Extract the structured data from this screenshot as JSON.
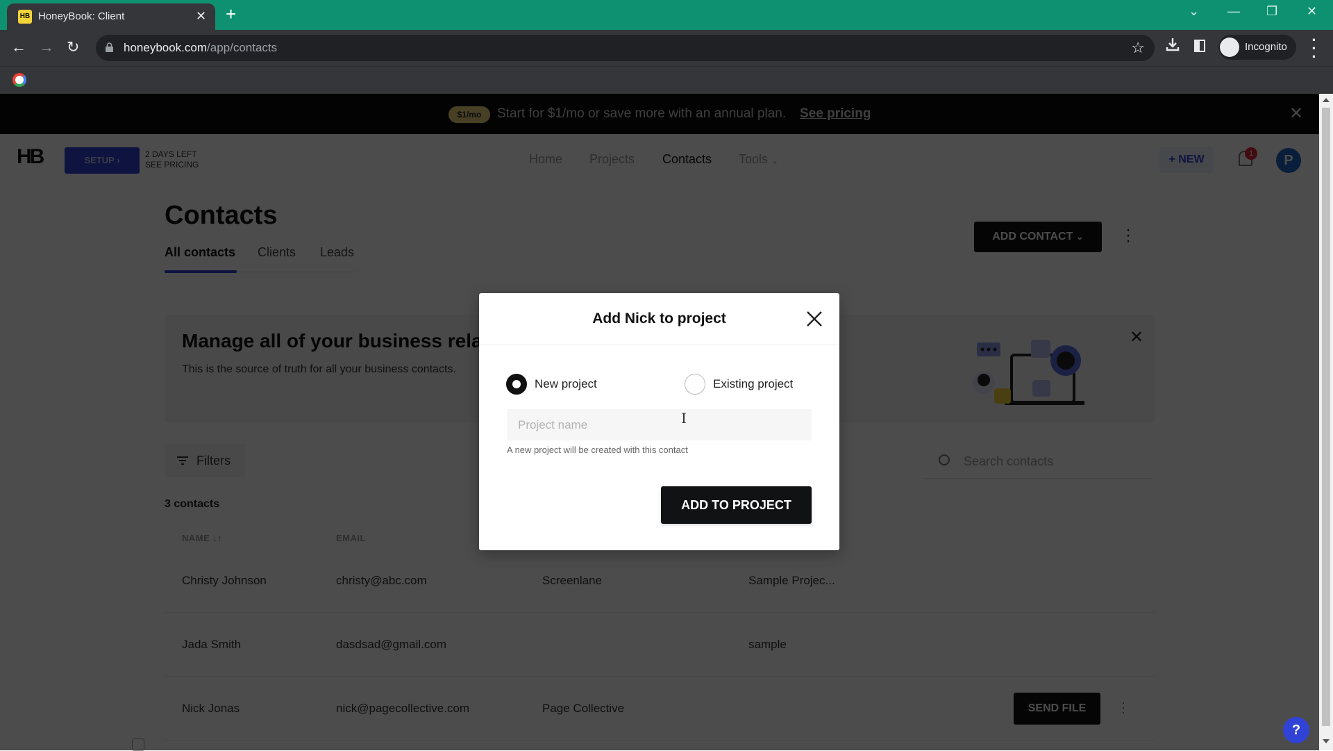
{
  "browser": {
    "tab_title": "HoneyBook: Client",
    "tab_favicon": "HB",
    "url_host": "honeybook.com",
    "url_path": "/app/contacts",
    "profile_label": "Incognito",
    "icons": [
      "back-icon",
      "forward-icon",
      "reload-icon",
      "lock-icon",
      "star-icon",
      "download-icon",
      "side-panel-icon",
      "incognito-icon",
      "kebab-menu-icon",
      "google-icon"
    ]
  },
  "promo": {
    "badge": "$1/mo",
    "text": "Start for $1/mo or save more with an annual plan.",
    "link": "See pricing"
  },
  "header": {
    "logo": "HB",
    "setup_label": "SETUP",
    "trial_line1": "2 DAYS LEFT",
    "trial_line2": "SEE PRICING",
    "nav": [
      "Home",
      "Projects",
      "Contacts",
      "Tools"
    ],
    "active_nav": "Contacts",
    "new_label": "+ NEW",
    "notification_count": "1",
    "avatar_initial": "P"
  },
  "contacts": {
    "title": "Contacts",
    "tabs": [
      "All contacts",
      "Clients",
      "Leads"
    ],
    "active_tab": "All contacts",
    "add_contact_label": "ADD CONTACT",
    "info_title": "Manage all of your business relationships",
    "info_title_visible": "Manage all of your business rela",
    "info_subtitle": "This is the source of truth for all your business contacts.",
    "filters_label": "Filters",
    "search_placeholder": "Search contacts",
    "count_label": "3 contacts",
    "columns": [
      "NAME",
      "EMAIL"
    ],
    "rows": [
      {
        "name": "Christy Johnson",
        "email": "christy@abc.com",
        "company": "Screenlane",
        "project": "Sample Projec..."
      },
      {
        "name": "Jada Smith",
        "email": "dasdsad@gmail.com",
        "company": "",
        "project": "sample"
      },
      {
        "name": "Nick Jonas",
        "email": "nick@pagecollective.com",
        "company": "Page Collective",
        "project": ""
      }
    ],
    "send_file_label": "SEND FILE",
    "help_label": "?"
  },
  "modal": {
    "title": "Add Nick to project",
    "options": [
      "New project",
      "Existing project"
    ],
    "selected_option": "New project",
    "project_name_placeholder": "Project name",
    "project_name_value": "",
    "helper_text": "A new project will be created with this contact",
    "submit_label": "ADD TO PROJECT"
  },
  "colors": {
    "tabbar": "#0e9170",
    "brand_blue": "#3142d6",
    "primary_button": "#111214",
    "badge_red": "#e0293a",
    "promo_badge": "#efd57a"
  }
}
